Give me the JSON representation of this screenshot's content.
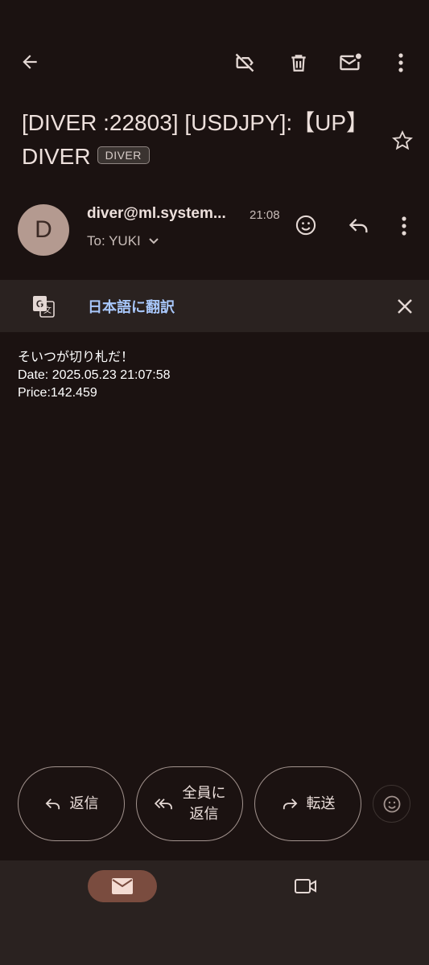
{
  "subject": {
    "text": "[DIVER :22803] [USDJPY]:【UP】DIVER",
    "label": "DIVER"
  },
  "sender": {
    "avatar_letter": "D",
    "address": "diver@ml.system...",
    "time": "21:08",
    "to": "To: YUKI"
  },
  "translate": {
    "label": "日本語に翻訳"
  },
  "body": {
    "line1": "そいつが切り札だ！",
    "line2": "Date: 2025.05.23 21:07:58",
    "line3": "Price:142.459"
  },
  "actions": {
    "reply": "返信",
    "reply_all_line1": "全員に",
    "reply_all_line2": "返信",
    "forward": "転送"
  },
  "icons": {
    "back": "arrow-back-icon",
    "label_off": "label-off-icon",
    "delete": "trash-icon",
    "mark_unread": "mail-unread-icon",
    "more": "more-vert-icon",
    "star": "star-icon",
    "emoji": "emoji-icon",
    "reply": "reply-icon",
    "translate": "translate-icon",
    "close": "close-icon",
    "mail_nav": "mail-icon",
    "meet_nav": "videocam-icon"
  },
  "colors": {
    "background": "#1b1211",
    "translate_link": "#a8c7fa",
    "nav_active": "#7a4c3f"
  }
}
